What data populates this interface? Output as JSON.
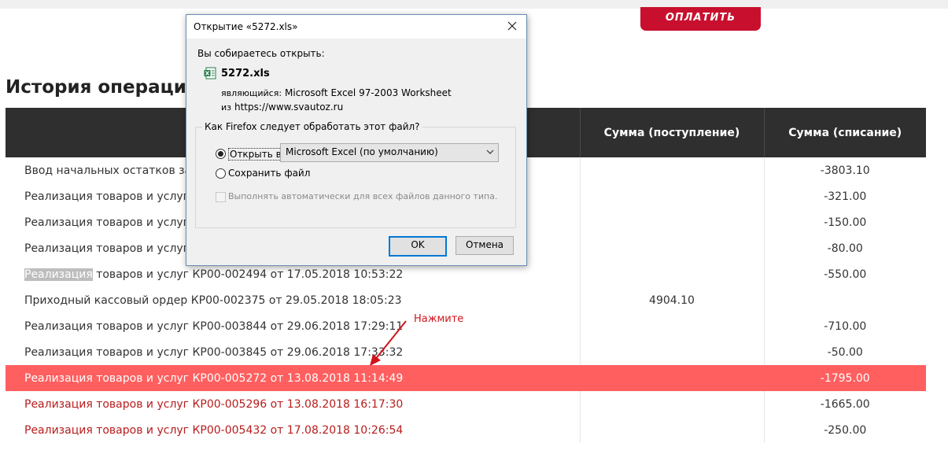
{
  "page": {
    "pay_button": "ОПЛАТИТЬ",
    "section_title": "История операций",
    "table": {
      "headers": [
        "",
        "Сумма (поступление)",
        "Сумма (списание)"
      ],
      "rows": [
        {
          "desc": "Ввод начальных остатков задо",
          "income": "",
          "expense": "-3803.10",
          "style": "normal"
        },
        {
          "desc": "Реализация товаров и услуг 00",
          "income": "",
          "expense": "-321.00",
          "style": "normal"
        },
        {
          "desc": "Реализация товаров и услуг 00",
          "income": "",
          "expense": "-150.00",
          "style": "normal"
        },
        {
          "desc": "Реализация товаров и услуг КР",
          "income": "",
          "expense": "-80.00",
          "style": "normal"
        },
        {
          "desc_selected": "Реализация",
          "desc_rest": " товаров и услуг КР00-002494 от 17.05.2018 10:53:22",
          "income": "",
          "expense": "-550.00",
          "style": "normal"
        },
        {
          "desc": "Приходный кассовый ордер КР00-002375 от 29.05.2018 18:05:23",
          "income": "4904.10",
          "expense": "",
          "style": "normal"
        },
        {
          "desc": "Реализация товаров и услуг КР00-003844 от 29.06.2018 17:29:11",
          "income": "",
          "expense": "-710.00",
          "style": "normal"
        },
        {
          "desc": "Реализация товаров и услуг КР00-003845 от 29.06.2018 17:33:32",
          "income": "",
          "expense": "-50.00",
          "style": "normal"
        },
        {
          "desc": "Реализация товаров и услуг КР00-005272 от 13.08.2018 11:14:49",
          "income": "",
          "expense": "-1795.00",
          "style": "highlight"
        },
        {
          "desc": "Реализация товаров и услуг КР00-005296 от 13.08.2018 16:17:30",
          "income": "",
          "expense": "-1665.00",
          "style": "red"
        },
        {
          "desc": "Реализация товаров и услуг КР00-005432 от 17.08.2018 10:26:54",
          "income": "",
          "expense": "-250.00",
          "style": "red"
        }
      ]
    },
    "callout": "Нажмите"
  },
  "dialog": {
    "title": "Открытие «5272.xls»",
    "prompt": "Вы собираетесь открыть:",
    "file_icon": "excel-file-icon",
    "file_name": "5272.xls",
    "type_label": "являющийся:",
    "type_value": "Microsoft Excel 97-2003 Worksheet",
    "from_label": "из",
    "from_value": "https://www.svautoz.ru",
    "question": "Как Firefox следует обработать этот файл?",
    "open_with_label": "Открыть в",
    "open_with_value": "Microsoft Excel (по умолчанию)",
    "save_label": "Сохранить файл",
    "auto_label": "Выполнять автоматически для всех файлов данного типа.",
    "ok_label": "OK",
    "cancel_label": "Отмена"
  },
  "colors": {
    "pay_button": "#c8102e",
    "header_bg": "#2f2f2f",
    "highlight_row": "#ff5f5f",
    "red_text": "#b81c1c",
    "callout": "#d0141b",
    "ok_border": "#0078d7"
  }
}
